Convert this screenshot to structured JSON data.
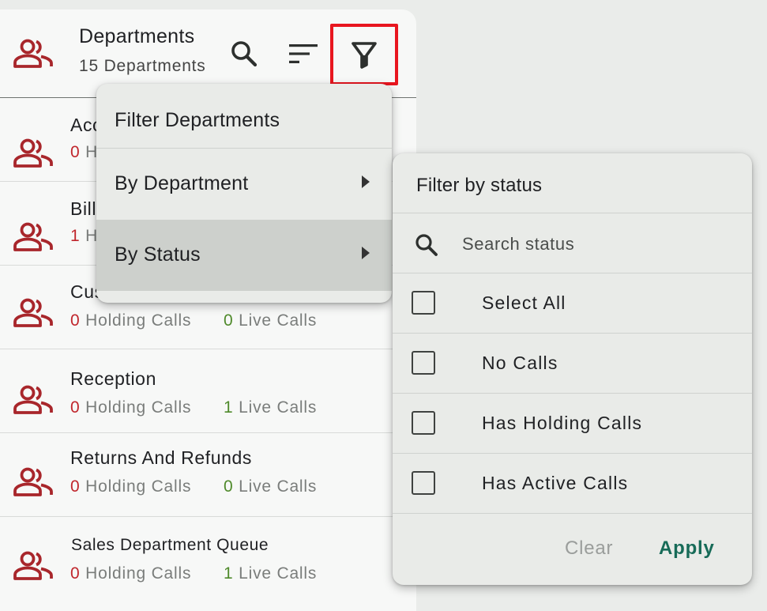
{
  "header": {
    "title": "Departments",
    "subtitle": "15 Departments",
    "icons": {
      "department": "people-icon",
      "search": "search-icon",
      "sort": "sort-icon",
      "filter": "filter-icon"
    }
  },
  "departments": [
    {
      "name": "Acc",
      "holding": "0",
      "holding_label": "H",
      "live": "",
      "live_label": ""
    },
    {
      "name": "Bill",
      "holding": "1",
      "holding_label": "H",
      "live": "",
      "live_label": ""
    },
    {
      "name": "Cus",
      "holding": "0",
      "holding_label": "Holding Calls",
      "live": "0",
      "live_label": "Live Calls"
    },
    {
      "name": "Reception",
      "holding": "0",
      "holding_label": "Holding Calls",
      "live": "1",
      "live_label": "Live Calls"
    },
    {
      "name": "Returns And Refunds",
      "holding": "0",
      "holding_label": "Holding Calls",
      "live": "0",
      "live_label": "Live Calls"
    },
    {
      "name": "Sales Department Queue",
      "holding": "0",
      "holding_label": "Holding Calls",
      "live": "1",
      "live_label": "Live Calls"
    }
  ],
  "filter_menu": {
    "title": "Filter Departments",
    "items": [
      {
        "label": "By Department"
      },
      {
        "label": "By Status"
      }
    ]
  },
  "status_filter": {
    "title": "Filter by status",
    "search_placeholder": "Search status",
    "options": [
      {
        "label": "Select All",
        "checked": false
      },
      {
        "label": "No Calls",
        "checked": false
      },
      {
        "label": "Has Holding Calls",
        "checked": false
      },
      {
        "label": "Has Active Calls",
        "checked": false
      }
    ],
    "clear_label": "Clear",
    "apply_label": "Apply"
  },
  "colors": {
    "department_icon": "#a8262b",
    "holding_count": "#c0262c",
    "live_count": "#4f8a2b",
    "apply_button": "#176b58",
    "highlight_box": "#e8161f"
  }
}
